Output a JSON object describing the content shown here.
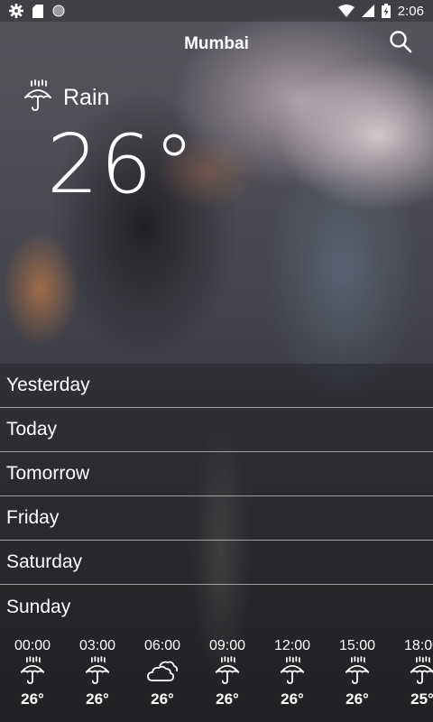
{
  "status_bar": {
    "time": "2:06",
    "icons_left": [
      "gear-icon",
      "sd-card-icon",
      "circle-icon"
    ],
    "icons_right": [
      "wifi-icon",
      "signal-icon",
      "battery-charging-icon"
    ]
  },
  "header": {
    "city": "Mumbai",
    "search_icon": "search-icon"
  },
  "current": {
    "condition": "Rain",
    "condition_icon": "rain-umbrella-icon",
    "temperature": "26°"
  },
  "days": [
    {
      "label": "Yesterday"
    },
    {
      "label": "Today"
    },
    {
      "label": "Tomorrow"
    },
    {
      "label": "Friday"
    },
    {
      "label": "Saturday"
    },
    {
      "label": "Sunday"
    }
  ],
  "hourly": [
    {
      "time": "00:00",
      "icon": "rain-umbrella-icon",
      "temp": "26°"
    },
    {
      "time": "03:00",
      "icon": "rain-umbrella-icon",
      "temp": "26°"
    },
    {
      "time": "06:00",
      "icon": "cloud-icon",
      "temp": "26°"
    },
    {
      "time": "09:00",
      "icon": "rain-umbrella-icon",
      "temp": "26°"
    },
    {
      "time": "12:00",
      "icon": "rain-umbrella-icon",
      "temp": "26°"
    },
    {
      "time": "15:00",
      "icon": "rain-umbrella-icon",
      "temp": "26°"
    },
    {
      "time": "18:00",
      "icon": "rain-umbrella-icon",
      "temp": "25°"
    }
  ]
}
